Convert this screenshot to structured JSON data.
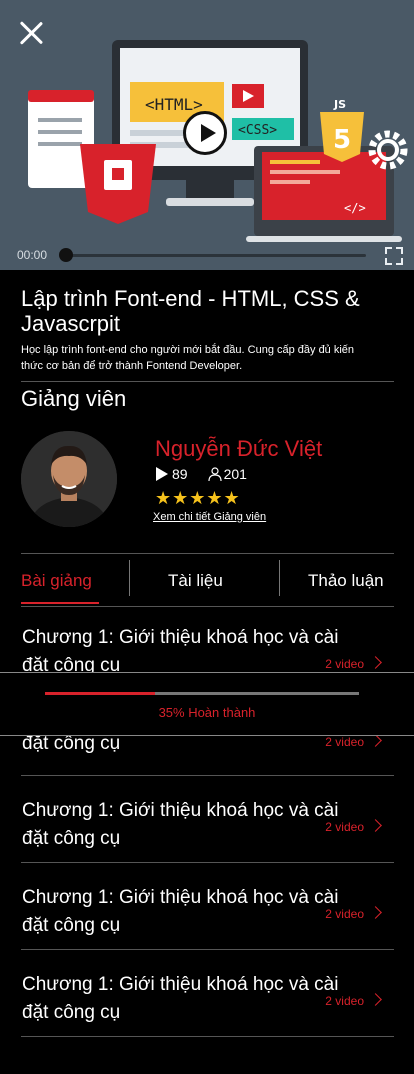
{
  "video": {
    "time": "00:00",
    "art_labels": {
      "html": "<HTML>",
      "css": "<CSS>",
      "js": "JS",
      "five": "5",
      "code": "</>"
    },
    "colors": {
      "bg": "#4a5966",
      "accent": "#d8222b"
    }
  },
  "course": {
    "title": "Lập trình Font-end - HTML, CSS & Javascrpit",
    "description": "Học lập trình font-end  cho người mới bắt đầu.  Cung cấp đầy đủ kiến thức cơ bản để trở thành Fontend Developer."
  },
  "instructor": {
    "section_title": "Giảng viên",
    "name": "Nguyễn Đức Việt",
    "videos": "89",
    "students": "201",
    "rating": 5,
    "stars": "★★★★★",
    "detail_link": "Xem chi tiết Giảng viên"
  },
  "tabs": [
    {
      "label": "Bài giảng",
      "active": true
    },
    {
      "label": "Tài liệu",
      "active": false
    },
    {
      "label": "Thảo luận",
      "active": false
    }
  ],
  "chapters": [
    {
      "title": "Chương 1: Giới thiệu khoá học và cài đặt công cụ",
      "count": "2 video"
    },
    {
      "title": "Chương 1: Giới thiệu khoá học và cài đặt công cụ",
      "count": "2 video"
    },
    {
      "title": "Chương 1: Giới thiệu khoá học và cài đặt công cụ",
      "count": "2 video"
    },
    {
      "title": "Chương 1: Giới thiệu khoá học và cài đặt công cụ",
      "count": "2 video"
    },
    {
      "title": "Chương 1: Giới thiệu khoá học và cài đặt công cụ",
      "count": "2 video"
    }
  ],
  "progress": {
    "value": 0.35,
    "label": "35% Hoàn thành"
  },
  "icons": [
    "close-icon",
    "play-icon",
    "fullscreen-icon",
    "video-count-icon",
    "user-icon",
    "chevron-right-icon"
  ]
}
